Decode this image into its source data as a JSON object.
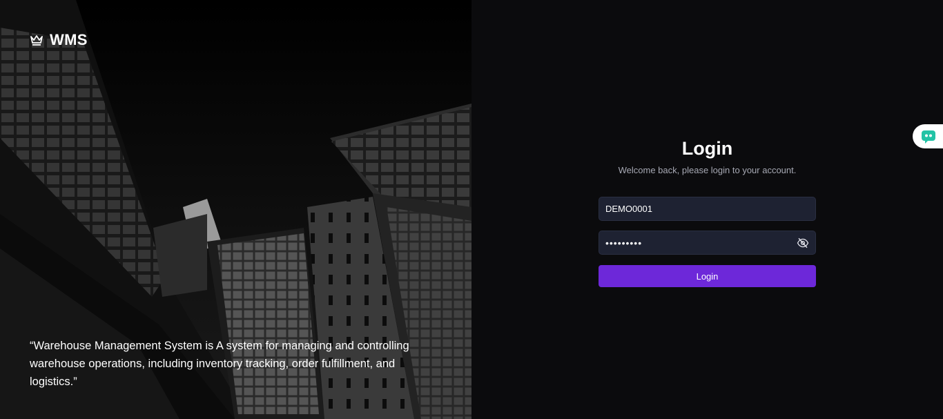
{
  "brand": {
    "name": "WMS",
    "icon": "crown-icon"
  },
  "hero": {
    "quote": "“Warehouse Management System is A system for managing and controlling warehouse operations, including inventory tracking, order fulfillment, and logistics.”"
  },
  "login": {
    "title": "Login",
    "subtitle": "Welcome back, please login to your account.",
    "username_value": "DEMO0001",
    "password_value": "•••••••••",
    "password_toggle_icon": "eye-off-icon",
    "submit_label": "Login"
  },
  "chat_widget": {
    "icon": "chat-bubble-icon",
    "color": "#22c3a6"
  },
  "colors": {
    "accent": "#6d28d9",
    "input_bg": "#1e2232",
    "panel_bg": "#0b0b0d"
  }
}
